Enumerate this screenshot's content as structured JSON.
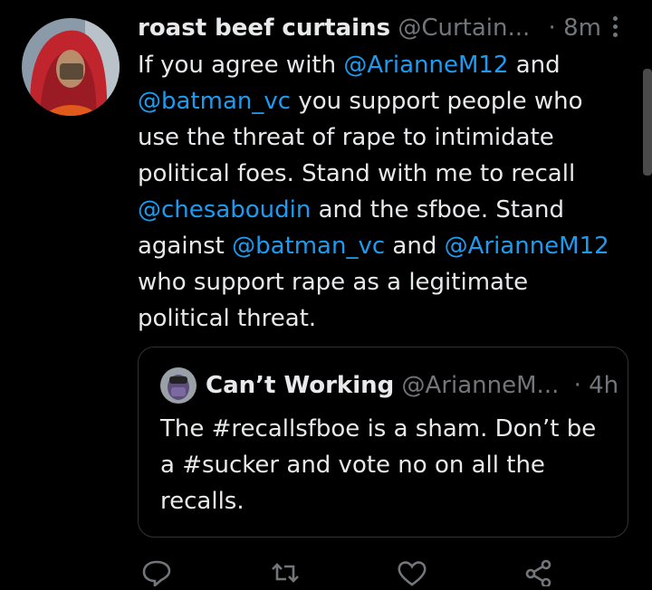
{
  "tweet": {
    "display_name": "roast beef curtains",
    "handle": "@Curtain...",
    "dot": "·",
    "time": "8m",
    "text_parts": [
      {
        "t": "If you agree with ",
        "m": false
      },
      {
        "t": "@ArianneM12",
        "m": true
      },
      {
        "t": " and ",
        "m": false
      },
      {
        "t": "@batman_vc",
        "m": true
      },
      {
        "t": " you support people who use the threat of rape to intimidate political foes. Stand with me to recall ",
        "m": false
      },
      {
        "t": "@chesaboudin",
        "m": true
      },
      {
        "t": " and the sfboe. Stand against ",
        "m": false
      },
      {
        "t": "@batman_vc",
        "m": true
      },
      {
        "t": " and ",
        "m": false
      },
      {
        "t": "@ArianneM12",
        "m": true
      },
      {
        "t": " who support rape as a legitimate political threat.",
        "m": false
      }
    ]
  },
  "quote": {
    "display_name": "Can’t Working",
    "handle": "@ArianneM...",
    "dot": "·",
    "time": "4h",
    "text": "The #recallsfboe is a sham. Don’t be a #sucker and vote no on all the recalls."
  },
  "actions": [
    "reply-icon",
    "retweet-icon",
    "like-icon",
    "share-icon"
  ],
  "colors": {
    "accent": "#1d9bf0",
    "muted": "#71767b",
    "background": "#000000",
    "text": "#e7e9ea"
  }
}
